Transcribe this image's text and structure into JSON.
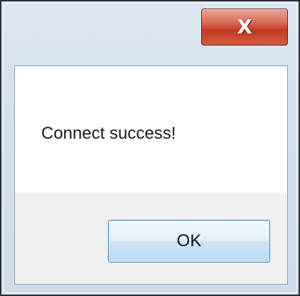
{
  "window": {
    "close_glyph": "X",
    "close_icon": "close-icon"
  },
  "dialog": {
    "message": "Connect success!",
    "ok_label": "OK"
  },
  "colors": {
    "close_button": "#c13a20",
    "ok_button_border": "#3c7fb1",
    "frame": "#d3e0ee"
  }
}
